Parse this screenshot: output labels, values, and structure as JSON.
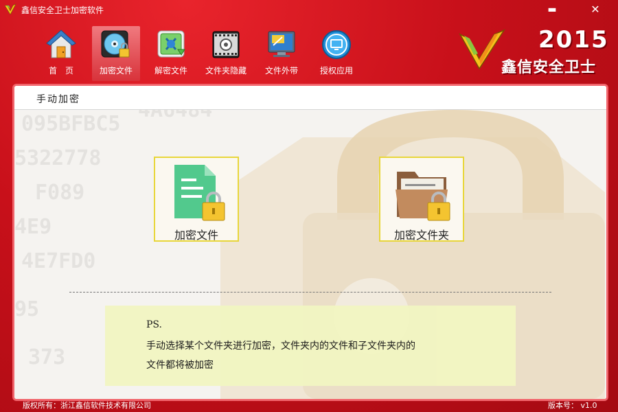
{
  "window": {
    "title": "鑫信安全卫士加密软件",
    "minimize_glyph": "▬",
    "close_glyph": "✕"
  },
  "toolbar": {
    "items": [
      {
        "label": "首　页",
        "icon": "home-icon",
        "active": false
      },
      {
        "label": "加密文件",
        "icon": "encrypt-disc-icon",
        "active": true
      },
      {
        "label": "解密文件",
        "icon": "decrypt-icon",
        "active": false
      },
      {
        "label": "文件夹隐藏",
        "icon": "film-reel-icon",
        "active": false
      },
      {
        "label": "文件外带",
        "icon": "monitor-icon",
        "active": false
      },
      {
        "label": "授权应用",
        "icon": "authorize-icon",
        "active": false
      }
    ]
  },
  "brand": {
    "year": "2015",
    "name": "鑫信安全卫士"
  },
  "panel": {
    "title": "手动加密",
    "cards": [
      {
        "label": "加密文件",
        "icon": "locked-file-icon"
      },
      {
        "label": "加密文件夹",
        "icon": "locked-folder-icon"
      }
    ],
    "ps": {
      "line1": "PS.",
      "line2": "手动选择某个文件夹进行加密，文件夹内的文件和子文件夹内的",
      "line3": "文件都将被加密"
    }
  },
  "status": {
    "copyright": "版权所有：浙江鑫信软件技术有限公司",
    "version": "版本号： v1.0"
  },
  "colors": {
    "window_red": "#c8101a",
    "panel_border": "#f1646b",
    "card_border": "#e8d63a",
    "ps_background": "#f2f6c2",
    "brand_accent": "#f6c21c"
  }
}
